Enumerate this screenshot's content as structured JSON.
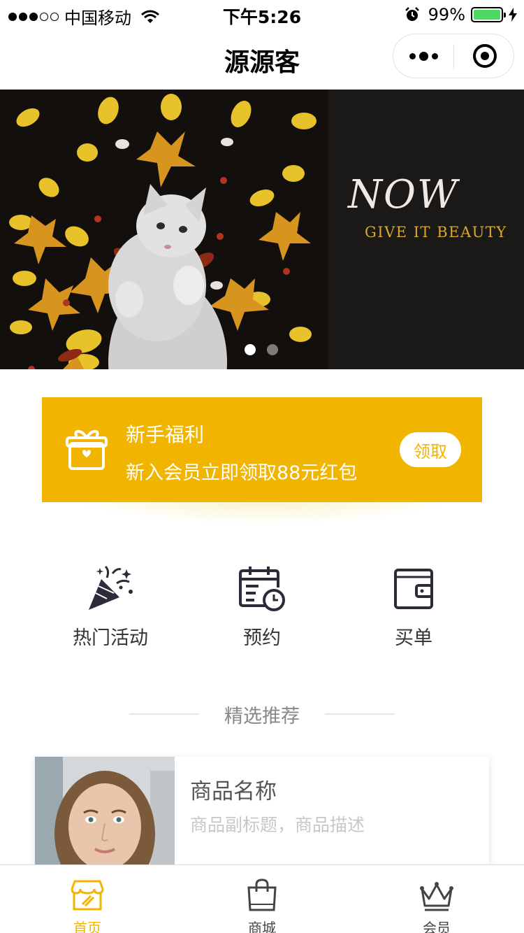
{
  "status_bar": {
    "carrier": "中国移动",
    "time": "下午5:26",
    "battery": "99%",
    "battery_level": 0.99
  },
  "nav": {
    "title": "源源客"
  },
  "banner": {
    "headline": "NOW",
    "tagline": "GIVE IT BEAUTY",
    "pages": 2,
    "active_page": 1
  },
  "welfare": {
    "title": "新手福利",
    "desc": "新入会员立即领取88元红包",
    "button": "领取"
  },
  "quick_actions": [
    {
      "label": "热门活动",
      "icon": "party-popper-icon"
    },
    {
      "label": "预约",
      "icon": "calendar-clock-icon"
    },
    {
      "label": "买单",
      "icon": "wallet-icon"
    }
  ],
  "section": {
    "title": "精选推荐"
  },
  "product": {
    "name": "商品名称",
    "subtitle": "商品副标题，商品描述"
  },
  "tabs": [
    {
      "label": "首页",
      "icon": "storefront-icon",
      "active": true
    },
    {
      "label": "商城",
      "icon": "shopping-bag-icon",
      "active": false
    },
    {
      "label": "会员",
      "icon": "crown-icon",
      "active": false
    }
  ],
  "colors": {
    "accent": "#f1b500",
    "banner_bg": "#14110f",
    "text": "#333333"
  }
}
